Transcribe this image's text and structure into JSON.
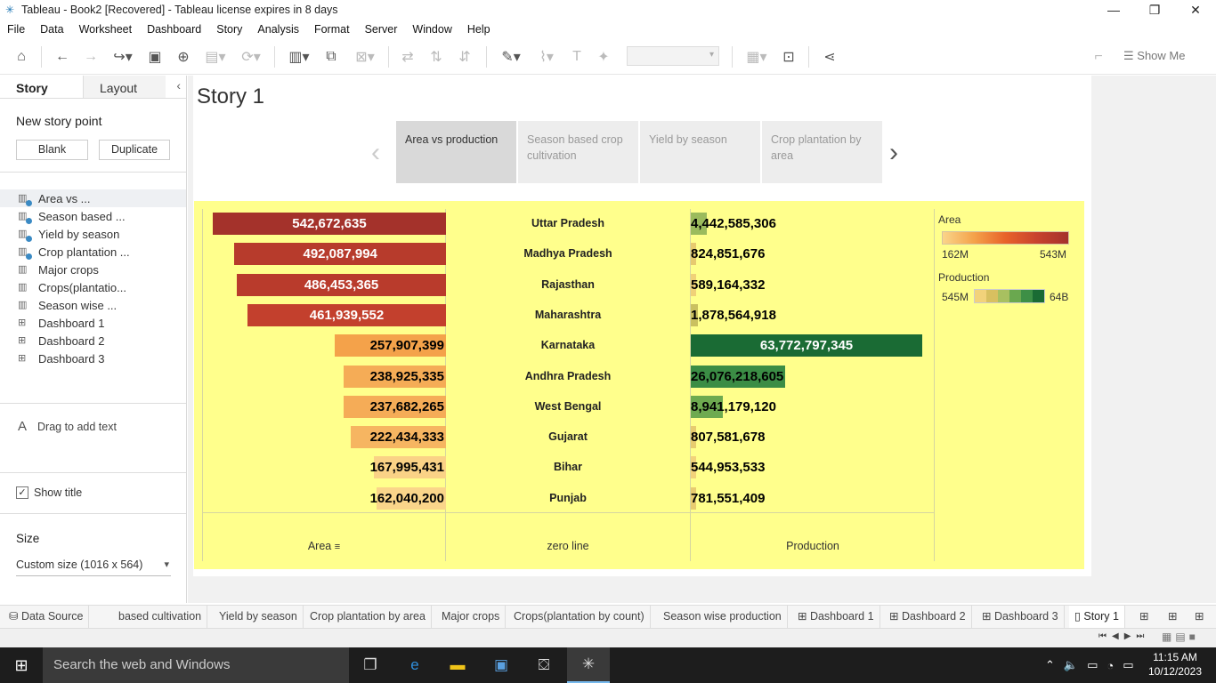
{
  "window": {
    "title": "Tableau - Book2 [Recovered] - Tableau license expires in 8 days",
    "minimize": "—",
    "restore": "❐",
    "close": "✕"
  },
  "menu": [
    "File",
    "Data",
    "Worksheet",
    "Dashboard",
    "Story",
    "Analysis",
    "Format",
    "Server",
    "Window",
    "Help"
  ],
  "toolbar": {
    "show_me": "Show Me"
  },
  "sidebar": {
    "tab_story": "Story",
    "tab_layout": "Layout",
    "new_story_point": "New story point",
    "blank_button": "Blank",
    "duplicate_button": "Duplicate",
    "items": [
      {
        "label": "Area vs ...",
        "icon": "sheet-icon",
        "selected": true
      },
      {
        "label": "Season based ...",
        "icon": "sheet-icon"
      },
      {
        "label": "Yield by season",
        "icon": "sheet-icon"
      },
      {
        "label": "Crop plantation ...",
        "icon": "sheet-icon"
      },
      {
        "label": "Major crops",
        "icon": "sheet-icon"
      },
      {
        "label": "Crops(plantatio...",
        "icon": "sheet-icon"
      },
      {
        "label": "Season wise ...",
        "icon": "sheet-icon"
      },
      {
        "label": "Dashboard 1",
        "icon": "dashboard-icon"
      },
      {
        "label": "Dashboard 2",
        "icon": "dashboard-icon"
      },
      {
        "label": "Dashboard 3",
        "icon": "dashboard-icon"
      }
    ],
    "drag_text_icon": "A",
    "drag_text": "Drag to add text",
    "show_title": "Show title",
    "show_title_checked": "✓",
    "size_label": "Size",
    "size_value": "Custom size (1016 x 564)"
  },
  "story": {
    "title": "Story 1",
    "points": [
      "Area vs production",
      "Season based crop cultivation",
      "Yield by season",
      "Crop plantation by area"
    ],
    "active_point": 0
  },
  "chart_data": {
    "type": "bar",
    "categories": [
      "Uttar Pradesh",
      "Madhya Pradesh",
      "Rajasthan",
      "Maharashtra",
      "Karnataka",
      "Andhra Pradesh",
      "West Bengal",
      "Gujarat",
      "Bihar",
      "Punjab"
    ],
    "series": [
      {
        "name": "Area",
        "values": [
          542672635,
          492087994,
          486453365,
          461939552,
          257907399,
          238925335,
          237682265,
          222434333,
          167995431,
          162040200
        ],
        "labels": [
          "542,672,635",
          "492,087,994",
          "486,453,365",
          "461,939,552",
          "257,907,399",
          "238,925,335",
          "237,682,265",
          "222,434,333",
          "167,995,431",
          "162,040,200"
        ]
      },
      {
        "name": "Production",
        "values": [
          4442585306,
          824851676,
          589164332,
          1878564918,
          63772797345,
          26076218605,
          8941179120,
          807581678,
          544953533,
          781551409
        ],
        "labels": [
          "4,442,585,306",
          "824,851,676",
          "589,164,332",
          "1,878,564,918",
          "63,772,797,345",
          "26,076,218,605",
          "8,941,179,120",
          "807,581,678",
          "544,953,533",
          "781,551,409"
        ]
      }
    ],
    "columns": [
      "Area",
      "zero line",
      "Production"
    ],
    "legend_area": {
      "title": "Area",
      "min": "162M",
      "max": "543M"
    },
    "legend_production": {
      "title": "Production",
      "min": "545M",
      "max": "64B"
    },
    "colors": {
      "area_high": "#a4322b",
      "area_low": "#fad58a",
      "prod_high": "#1a6b34",
      "prod_mid": "#6aa84f",
      "prod_low": "#f2d27a",
      "background": "#ffff8c"
    }
  },
  "sheet_tabs": [
    "Data Source",
    "based cultivation",
    "Yield by season",
    "Crop plantation by area",
    "Major crops",
    "Crops(plantation by count)",
    "Season wise production",
    "Dashboard 1",
    "Dashboard 2",
    "Dashboard 3",
    "Story 1"
  ],
  "taskbar": {
    "search": "Search the web and Windows",
    "time": "11:15 AM",
    "date": "10/12/2023"
  }
}
